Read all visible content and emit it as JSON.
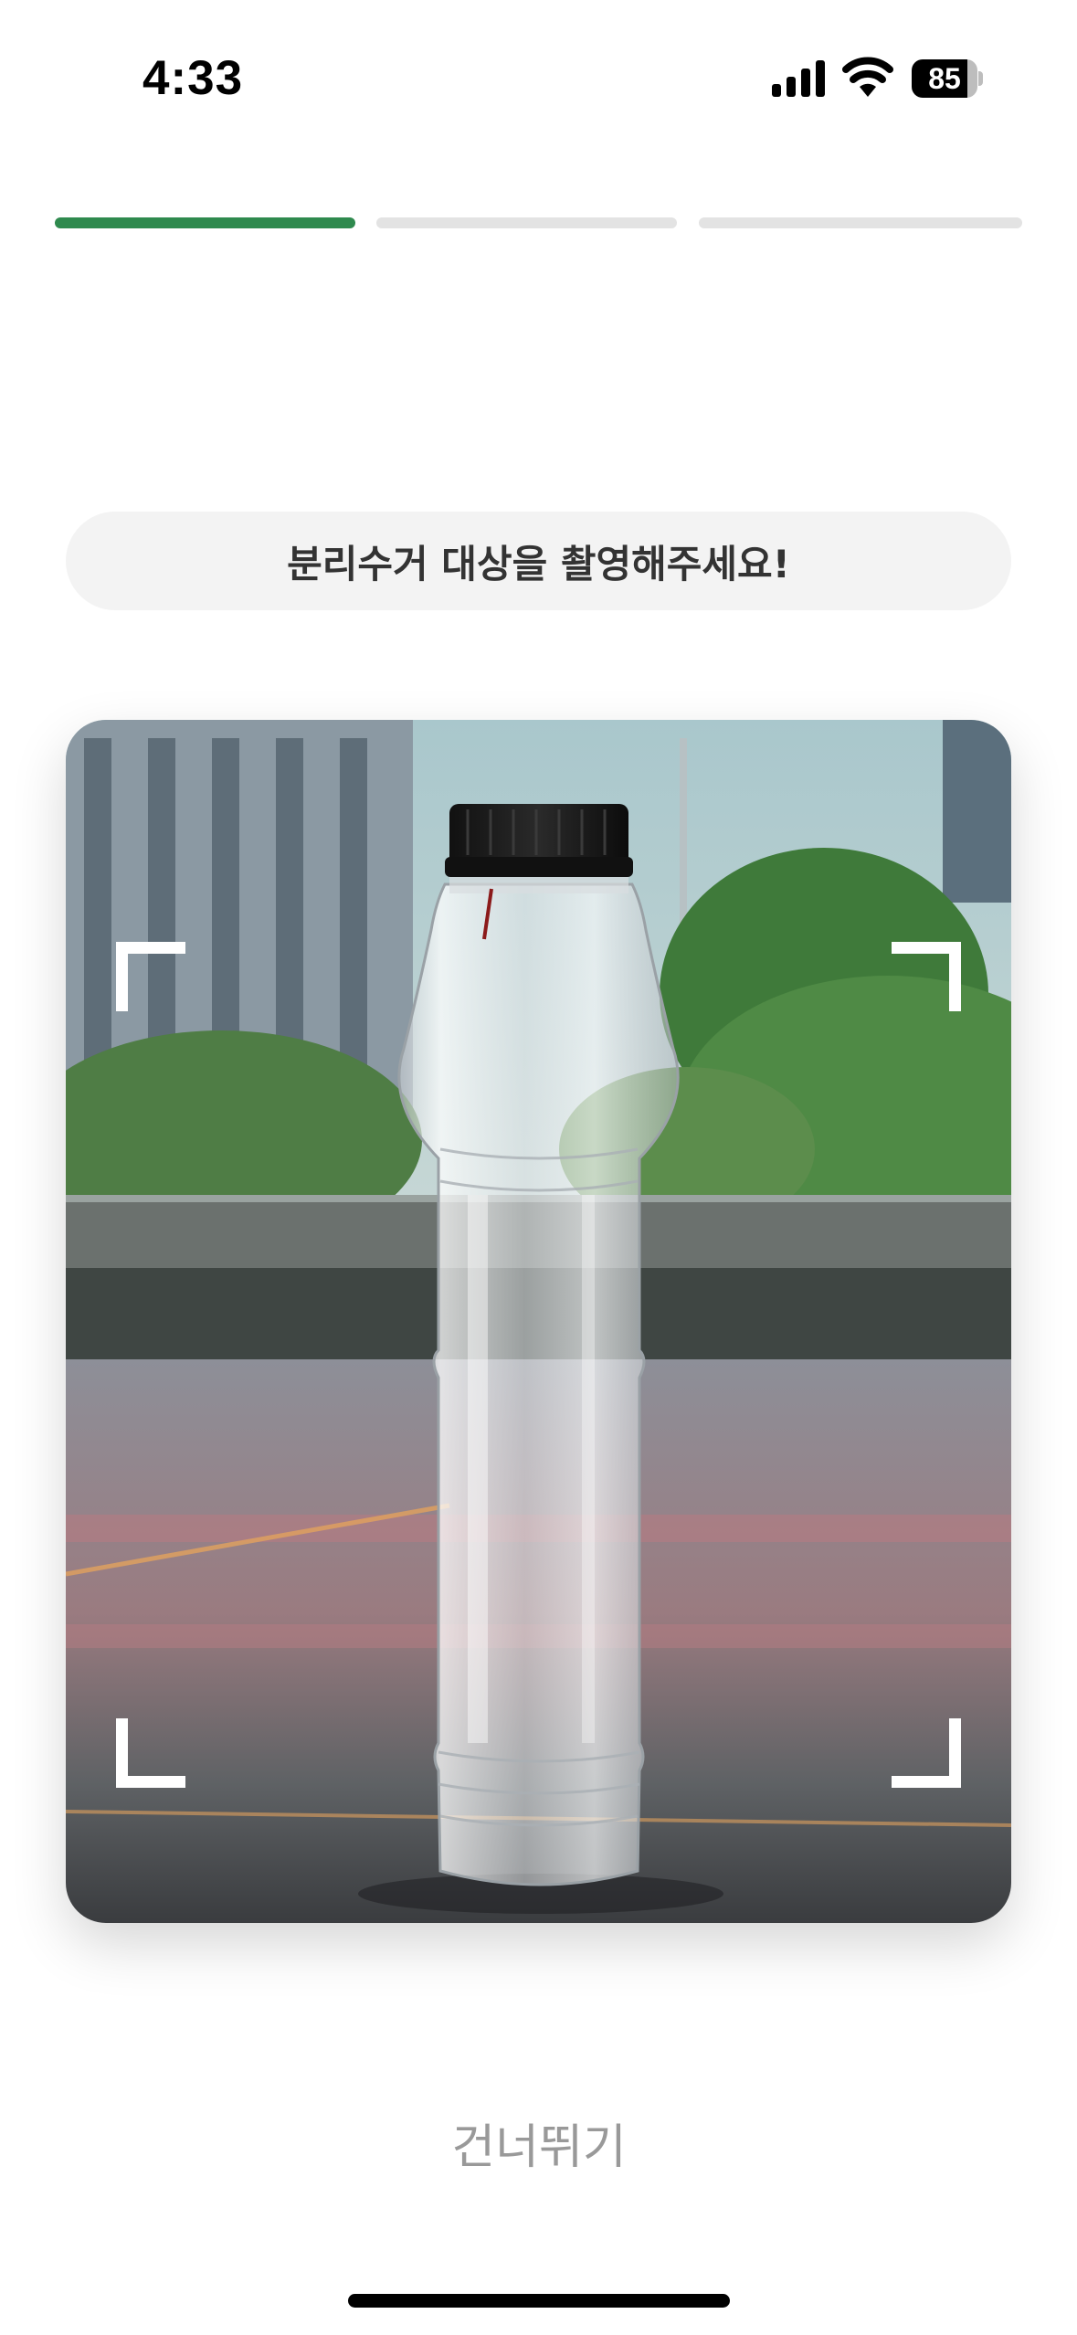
{
  "status_bar": {
    "time": "4:33",
    "battery_level": "85",
    "icons": [
      "signal-icon",
      "wifi-icon",
      "battery-icon"
    ]
  },
  "progress": {
    "current_step": 1,
    "total_steps": 3,
    "active_color": "#2f8a4e",
    "inactive_color": "#e3e3e3"
  },
  "instruction": {
    "text": "분리수거 대상을 촬영해주세요!"
  },
  "camera": {
    "subject": "plastic-water-bottle",
    "frame_icon": "scan-frame-corners"
  },
  "actions": {
    "skip_label": "건너뛰기"
  }
}
